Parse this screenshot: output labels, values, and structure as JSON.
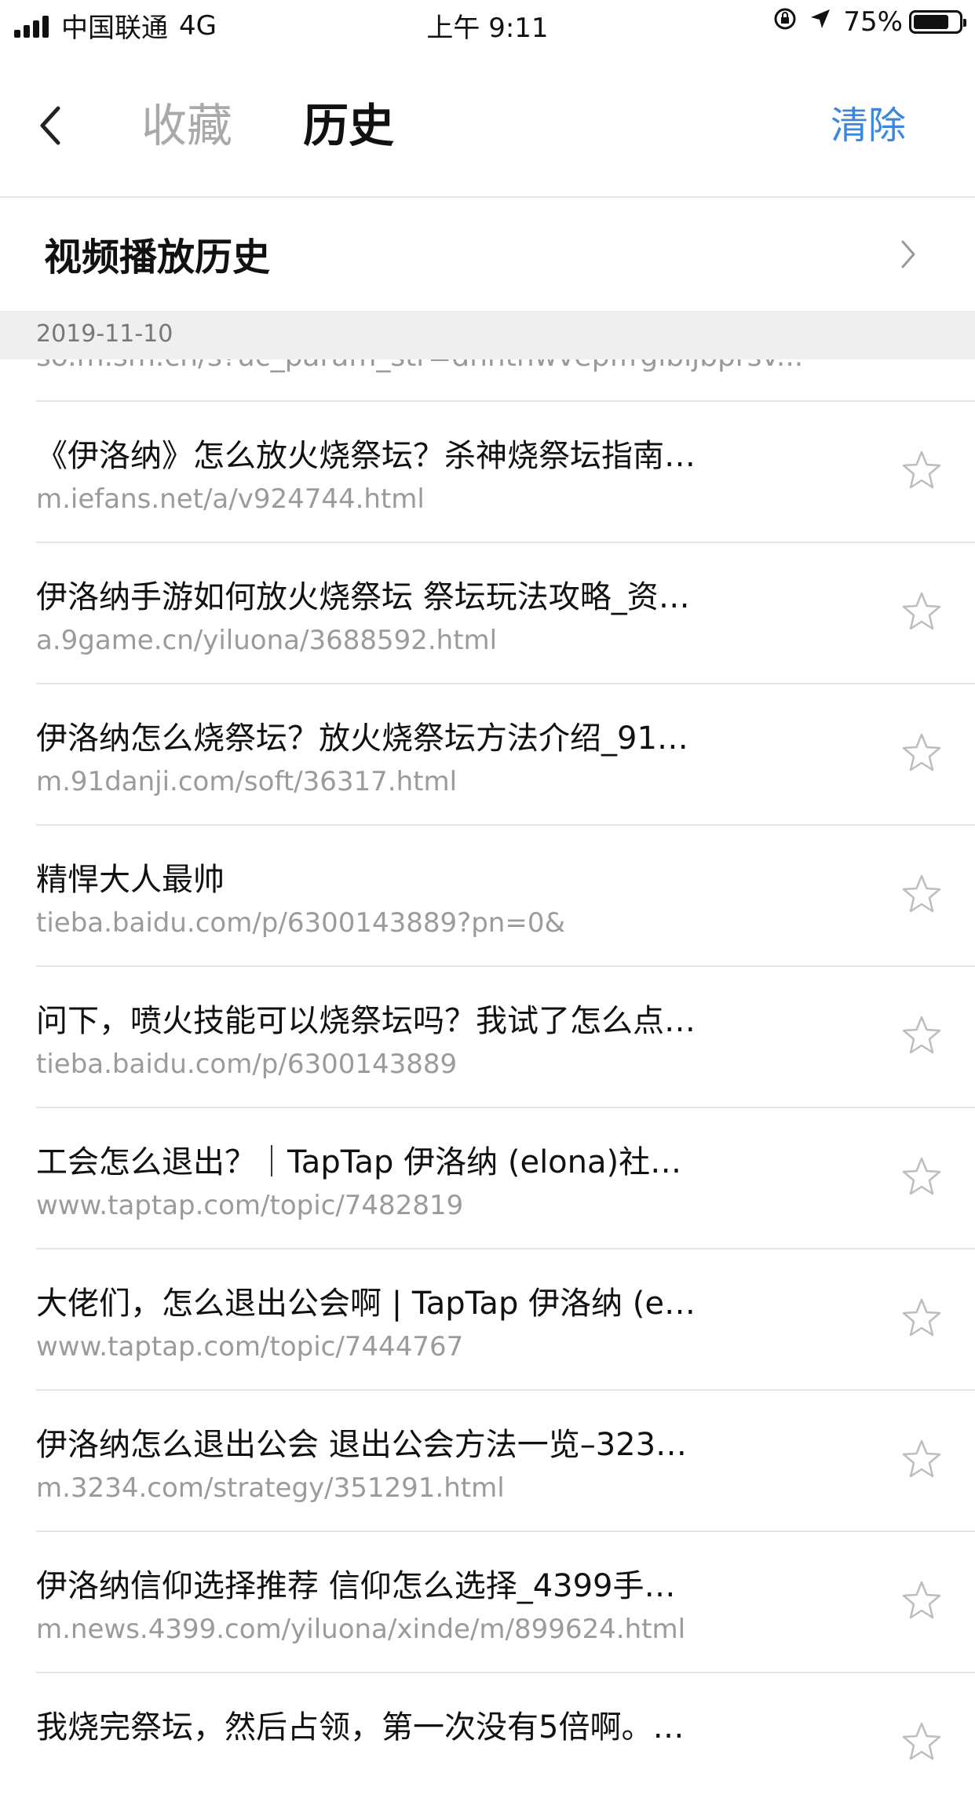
{
  "status_bar": {
    "carrier": "中国联通",
    "network": "4G",
    "time": "上午 9:11",
    "battery": "75%"
  },
  "nav": {
    "tabs": [
      {
        "label": "收藏",
        "active": false
      },
      {
        "label": "历史",
        "active": true
      }
    ],
    "clear_label": "清除"
  },
  "video_history": {
    "label": "视频播放历史"
  },
  "date_header": "2019-11-10",
  "partial_url": "so.m.sm.cn/s?uc_param_str=dnntnwvepffrgibijbprsv...",
  "items": [
    {
      "title": "《伊洛纳》怎么放火烧祭坛？杀神烧祭坛指南…",
      "url": "m.iefans.net/a/v924744.html"
    },
    {
      "title": "伊洛纳手游如何放火烧祭坛 祭坛玩法攻略_资…",
      "url": "a.9game.cn/yiluona/3688592.html"
    },
    {
      "title": "伊洛纳怎么烧祭坛？放火烧祭坛方法介绍_91…",
      "url": "m.91danji.com/soft/36317.html"
    },
    {
      "title": "精悍大人最帅",
      "url": "tieba.baidu.com/p/6300143889?pn=0&"
    },
    {
      "title": "问下，喷火技能可以烧祭坛吗？我试了怎么点…",
      "url": "tieba.baidu.com/p/6300143889"
    },
    {
      "title": "工会怎么退出？｜TapTap 伊洛纳 (elona)社…",
      "url": "www.taptap.com/topic/7482819"
    },
    {
      "title": "大佬们，怎么退出公会啊 | TapTap 伊洛纳 (e…",
      "url": "www.taptap.com/topic/7444767"
    },
    {
      "title": "伊洛纳怎么退出公会 退出公会方法一览–323…",
      "url": "m.3234.com/strategy/351291.html"
    },
    {
      "title": "伊洛纳信仰选择推荐 信仰怎么选择_4399手…",
      "url": "m.news.4399.com/yiluona/xinde/m/899624.html"
    },
    {
      "title": "我烧完祭坛，然后占领，第一次没有5倍啊。…",
      "url": ""
    }
  ],
  "colors": {
    "accent": "#3b87e0",
    "inactive_tab": "#a9a9a9",
    "secondary_text": "#9b9b9b",
    "section_bg": "#efefef"
  }
}
